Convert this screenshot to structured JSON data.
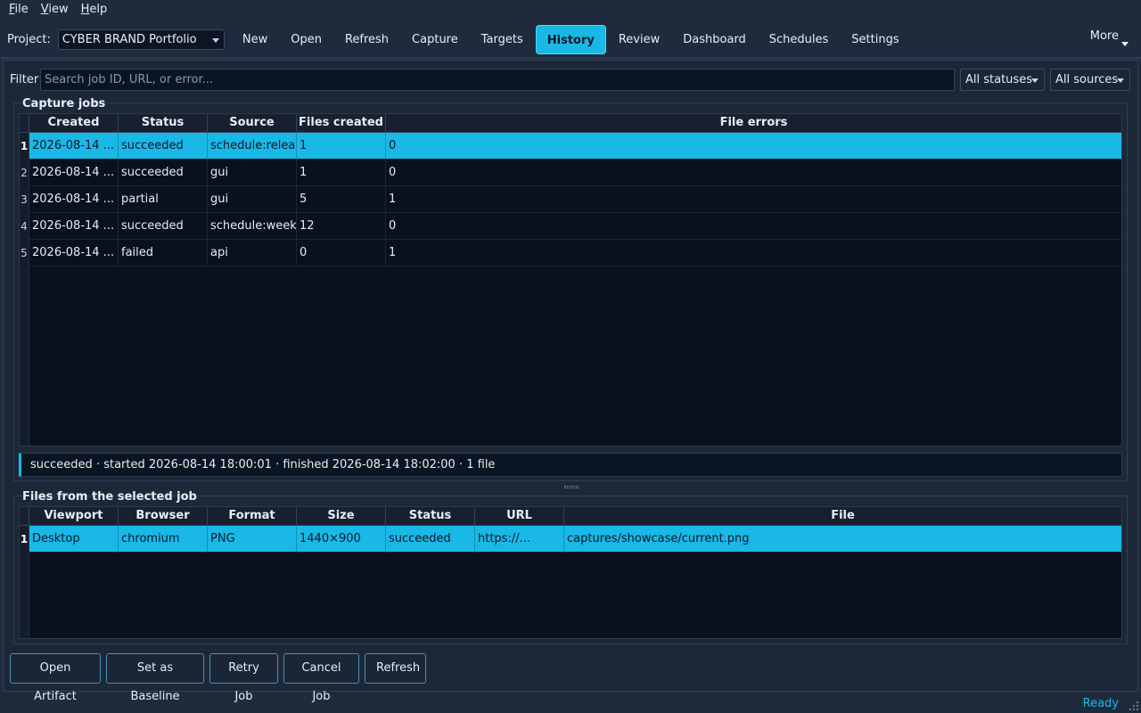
{
  "menu": [
    {
      "label": "File",
      "mnemonic": "F",
      "rest": "ile"
    },
    {
      "label": "View",
      "mnemonic": "V",
      "rest": "iew"
    },
    {
      "label": "Help",
      "mnemonic": "H",
      "rest": "elp"
    }
  ],
  "toolbar": {
    "project_label": "Project:",
    "project_value": "CYBER BRAND Portfolio",
    "tabs": [
      "New",
      "Open",
      "Refresh",
      "Capture",
      "Targets",
      "History",
      "Review",
      "Dashboard",
      "Schedules",
      "Settings"
    ],
    "active_tab": "History",
    "more_label": "More"
  },
  "filter": {
    "label": "Filter",
    "placeholder": "Search job ID, URL, or error...",
    "status_select": "All statuses",
    "source_select": "All sources"
  },
  "jobs": {
    "title": "Capture jobs",
    "columns": [
      "Created",
      "Status",
      "Source",
      "Files created",
      "File errors"
    ],
    "rows": [
      {
        "num": "1",
        "created": "2026-08-14 ...",
        "status": "succeeded",
        "source": "schedule:relea...",
        "files": "1",
        "errors": "0"
      },
      {
        "num": "2",
        "created": "2026-08-14 ...",
        "status": "succeeded",
        "source": "gui",
        "files": "1",
        "errors": "0"
      },
      {
        "num": "3",
        "created": "2026-08-14 ...",
        "status": "partial",
        "source": "gui",
        "files": "5",
        "errors": "1"
      },
      {
        "num": "4",
        "created": "2026-08-14 ...",
        "status": "succeeded",
        "source": "schedule:week...",
        "files": "12",
        "errors": "0"
      },
      {
        "num": "5",
        "created": "2026-08-14 ...",
        "status": "failed",
        "source": "api",
        "files": "0",
        "errors": "1"
      }
    ],
    "selected_row": 0,
    "summary": "succeeded · started 2026-08-14 18:00:01 · finished 2026-08-14 18:02:00 · 1 file"
  },
  "files": {
    "title": "Files from the selected job",
    "columns": [
      "Viewport",
      "Browser",
      "Format",
      "Size",
      "Status",
      "URL",
      "File"
    ],
    "rows": [
      {
        "num": "1",
        "viewport": "Desktop",
        "browser": "chromium",
        "format": "PNG",
        "size": "1440×900",
        "status": "succeeded",
        "url": "https://...",
        "file": "captures/showcase/current.png"
      }
    ]
  },
  "actions": {
    "open_artifact": "Open Artifact",
    "set_baseline": "Set as Baseline",
    "retry_job": "Retry Job",
    "cancel_job": "Cancel Job",
    "refresh": "Refresh"
  },
  "statusbar": {
    "text": "Ready"
  },
  "colors": {
    "accent": "#19b8e6",
    "background": "#1f2b3c",
    "table_bg": "#0a111d"
  }
}
